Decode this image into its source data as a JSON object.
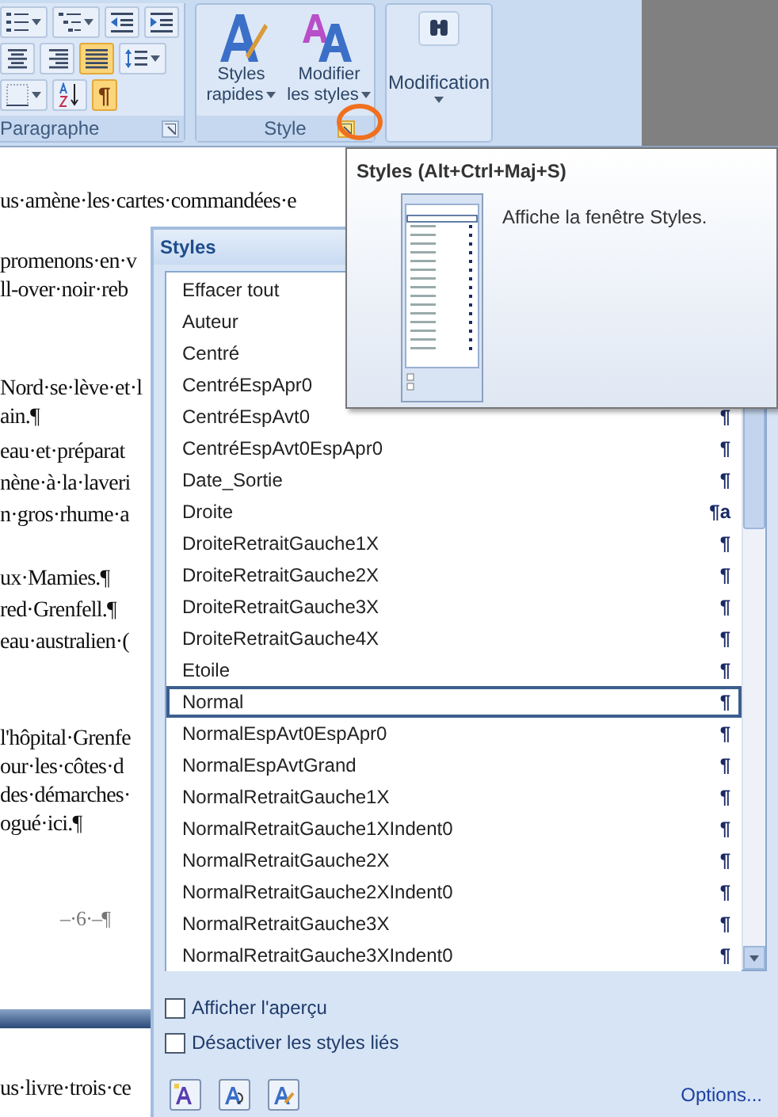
{
  "ribbon": {
    "paragraph_group": {
      "label": "Paragraphe",
      "rows": [
        [
          {
            "kind": "numbered-list",
            "dropdown": true,
            "selected": false
          },
          {
            "kind": "multilevel-list",
            "dropdown": true,
            "selected": false
          },
          {
            "kind": "decrease-indent",
            "dropdown": false,
            "selected": false
          },
          {
            "kind": "increase-indent",
            "dropdown": false,
            "selected": false
          }
        ],
        [
          {
            "kind": "align-center",
            "dropdown": false,
            "selected": false
          },
          {
            "kind": "align-right",
            "dropdown": false,
            "selected": false
          },
          {
            "kind": "justify",
            "dropdown": false,
            "selected": true
          },
          {
            "kind": "line-spacing",
            "dropdown": true,
            "selected": false
          }
        ],
        [
          {
            "kind": "borders",
            "dropdown": true,
            "selected": false
          },
          {
            "kind": "sort",
            "dropdown": false,
            "selected": false
          },
          {
            "kind": "text",
            "text": "¶",
            "dropdown": false,
            "selected": true
          }
        ]
      ]
    },
    "style_group": {
      "label": "Style",
      "buttons": [
        {
          "kind": "quick-styles",
          "label": "Styles rapides",
          "dropdown": true
        },
        {
          "kind": "change-styles",
          "label": "Modifier les styles",
          "dropdown": true
        }
      ],
      "launcher_highlighted": true
    },
    "editing_group": {
      "label": "Modification",
      "dropdown": true
    }
  },
  "document": {
    "paragraphs": [
      [
        "us·amène·les·cartes·commandées·e"
      ],
      [
        "promenons·en·v",
        "ll-over·noir·reb"
      ],
      [
        "Nord·se·lève·et·l",
        "ain.¶"
      ],
      [
        "eau·et·préparat"
      ],
      [
        "nène·à·la·laveri"
      ],
      [
        "n·gros·rhume·a"
      ],
      [
        "ux·Mamies.¶"
      ],
      [
        "red·Grenfell.¶"
      ],
      [
        "eau·australien·("
      ],
      [
        "l'hôpital·Grenfe",
        "our·les·côtes·d",
        "des·démarches·",
        "ogué·ici.¶"
      ]
    ],
    "page_number": "–·6·–¶",
    "next_page": [
      "us·livre·trois·ce"
    ]
  },
  "styles_pane": {
    "title": "Styles",
    "items": [
      {
        "name": "Effacer tout",
        "selected": false
      },
      {
        "name": "Auteur",
        "selected": false
      },
      {
        "name": "Centré",
        "selected": false
      },
      {
        "name": "CentréEspApr0",
        "selected": false
      },
      {
        "name": "CentréEspAvt0",
        "mark": "¶",
        "selected": false
      },
      {
        "name": "CentréEspAvt0EspApr0",
        "mark": "¶",
        "selected": false
      },
      {
        "name": "Date_Sortie",
        "mark": "¶",
        "selected": false
      },
      {
        "name": "Droite",
        "mark": "¶a",
        "selected": false
      },
      {
        "name": "DroiteRetraitGauche1X",
        "mark": "¶",
        "selected": false
      },
      {
        "name": "DroiteRetraitGauche2X",
        "mark": "¶",
        "selected": false
      },
      {
        "name": "DroiteRetraitGauche3X",
        "mark": "¶",
        "selected": false
      },
      {
        "name": "DroiteRetraitGauche4X",
        "mark": "¶",
        "selected": false
      },
      {
        "name": "Etoile",
        "mark": "¶",
        "selected": false
      },
      {
        "name": "Normal",
        "mark": "¶",
        "selected": true
      },
      {
        "name": "NormalEspAvt0EspApr0",
        "mark": "¶",
        "selected": false
      },
      {
        "name": "NormalEspAvtGrand",
        "mark": "¶",
        "selected": false
      },
      {
        "name": "NormalRetraitGauche1X",
        "mark": "¶",
        "selected": false
      },
      {
        "name": "NormalRetraitGauche1XIndent0",
        "mark": "¶",
        "selected": false
      },
      {
        "name": "NormalRetraitGauche2X",
        "mark": "¶",
        "selected": false
      },
      {
        "name": "NormalRetraitGauche2XIndent0",
        "mark": "¶",
        "selected": false
      },
      {
        "name": "NormalRetraitGauche3X",
        "mark": "¶",
        "selected": false
      },
      {
        "name": "NormalRetraitGauche3XIndent0",
        "mark": "¶",
        "selected": false
      }
    ],
    "checkboxes": [
      {
        "label": "Afficher l'aperçu",
        "checked": false
      },
      {
        "label": "Désactiver les styles liés",
        "checked": false
      }
    ],
    "options_link": "Options..."
  },
  "tooltip": {
    "title": "Styles (Alt+Ctrl+Maj+S)",
    "description": "Affiche la fenêtre Styles."
  }
}
